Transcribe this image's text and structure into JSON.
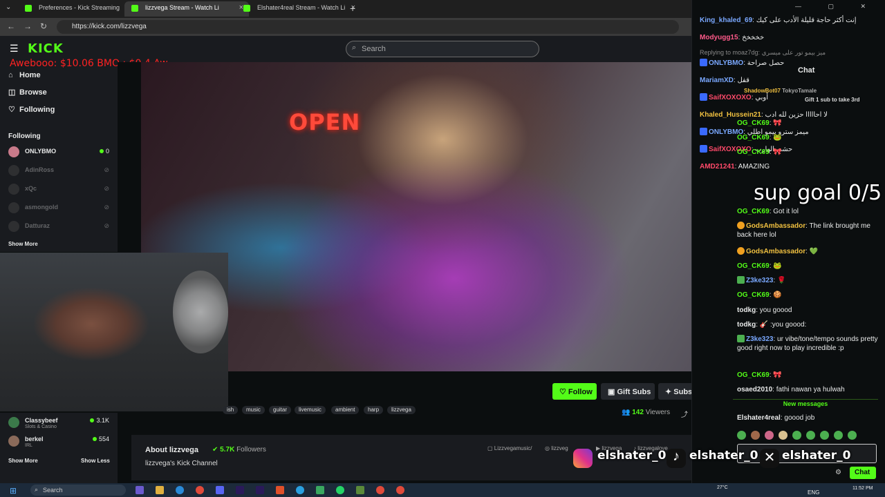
{
  "browser": {
    "tabs": [
      {
        "label": "Preferences - Kick Streaming",
        "active": false
      },
      {
        "label": "lizzvega Stream - Watch Li",
        "active": true
      },
      {
        "label": "Elshater4real Stream - Watch Li",
        "active": false
      }
    ],
    "url": "https://kick.com/lizzvega"
  },
  "kick": {
    "logo": "KICK",
    "search_placeholder": "Search"
  },
  "overlay_text": "Awebooo: $10.06    BMO : $0.4    Aw",
  "sidebar": {
    "nav": [
      {
        "label": "Home",
        "icon": "home-icon"
      },
      {
        "label": "Browse",
        "icon": "compass-icon"
      },
      {
        "label": "Following",
        "icon": "heart-icon"
      }
    ],
    "following_title": "Following",
    "channels": [
      {
        "name": "ONLYBMO",
        "viewers": "0",
        "live": true
      },
      {
        "name": "AdinRoss",
        "viewers": "",
        "live": false
      },
      {
        "name": "xQc",
        "viewers": "",
        "live": false
      },
      {
        "name": "asmongold",
        "viewers": "",
        "live": false
      },
      {
        "name": "Datturaz",
        "viewers": "",
        "live": false
      }
    ],
    "show_more": "Show More",
    "recommended": [
      {
        "name": "Classybeef",
        "category": "Slots & Casino",
        "viewers": "3.1K"
      },
      {
        "name": "berkel",
        "category": "IRL",
        "viewers": "554"
      }
    ],
    "show_more_2": "Show More",
    "show_less": "Show Less"
  },
  "stream": {
    "sign": "OPEN",
    "actions": {
      "follow": "Follow",
      "gift": "Gift Subs",
      "subscribe": "Subscribe"
    },
    "tags": [
      "ish",
      "music",
      "guitar",
      "livemusic",
      "ambient",
      "harp",
      "lizzvega"
    ],
    "viewers": "142",
    "viewers_label": "Viewers",
    "about_title": "About lizzvega",
    "followers": "5.7K",
    "followers_label": "Followers",
    "about_sub": "lizzvega's Kick Channel",
    "socials": [
      "Lizzvegamusic/",
      "lizzveg",
      "lizzvega",
      "lizzvegalove"
    ]
  },
  "chat": {
    "title": "Chat",
    "goal": "sup goal 0/5",
    "back_messages": [
      {
        "user": "King_khaled_69",
        "color": "#7aa8ff",
        "text": "إنت أكثر حاجة قليلة الأدب على كيك"
      },
      {
        "user": "Modyugg15",
        "color": "#ff5a8a",
        "text": "خخخخخ"
      },
      {
        "user": "",
        "color": "#888888",
        "text": "Replying to moaz7dg: ميز بيمو تور على ميسري"
      },
      {
        "user": "ONLYBMO",
        "color": "#7aa8ff",
        "text": "حصل صراحة"
      },
      {
        "user": "MariamXD",
        "color": "#7aa8ff",
        "text": "قفل"
      },
      {
        "user": "SaifXOXOXO",
        "color": "#ff4a6a",
        "text": "أوبي"
      },
      {
        "user": "Khaled_Hussein21",
        "color": "#f0c040",
        "text": "لا احااااا حزين لله ادب"
      },
      {
        "user": "ONLYBMO",
        "color": "#7aa8ff",
        "text": "ميمز سترو بيمو اطلي"
      },
      {
        "user": "SaifXOXOXO",
        "color": "#ff4a6a",
        "text": "حشي الهارب"
      },
      {
        "user": "AMD21241",
        "color": "#ff4a6a",
        "text": ""
      }
    ],
    "messages": [
      {
        "user": "OG_CK69",
        "color": "#53fc18",
        "text": ""
      },
      {
        "user": "OG_CK69",
        "color": "#53fc18",
        "text": ""
      },
      {
        "user": "OG_CK69",
        "color": "#53fc18",
        "text": ""
      },
      {
        "user": "",
        "color": "#e9eaea",
        "text": "AMAZING"
      },
      {
        "user": "OG_CK69",
        "color": "#53fc18",
        "text": "Got it lol"
      },
      {
        "user": "GodsAmbassador",
        "color": "#f0c040",
        "text": "The link brought me back here lol"
      },
      {
        "user": "GodsAmbassador",
        "color": "#f0c040",
        "text": "💚"
      },
      {
        "user": "OG_CK69",
        "color": "#53fc18",
        "text": ""
      },
      {
        "user": "Z3ke323",
        "color": "#7aa8ff",
        "text": ""
      },
      {
        "user": "OG_CK69",
        "color": "#53fc18",
        "text": ""
      },
      {
        "user": "todkg",
        "color": "#e9eaea",
        "text": "you goood"
      },
      {
        "user": "todkg",
        "color": "#e9eaea",
        "text": ":you goood:"
      },
      {
        "user": "Z3ke323",
        "color": "#7aa8ff",
        "text": "ur vibe/tone/tempo sounds pretty good right now to play incredible :p"
      },
      {
        "user": "OG_CK69",
        "color": "#53fc18",
        "text": ""
      },
      {
        "user": "osaed2010",
        "color": "#e9eaea",
        "text": "fathi nawan ya hulwah"
      }
    ],
    "new_messages": "New messages",
    "last_message": {
      "user": "Elshater4real",
      "color": "#e9eaea",
      "text": "goood job"
    },
    "send_button": "Chat",
    "gift_promo": "Gift 1 sub to take 3rd",
    "gift_users": [
      "ShadowBot07",
      "TokyoTamale"
    ]
  },
  "watermark": {
    "handles": [
      "elshater_0",
      "elshater_0",
      "elshater_0"
    ]
  },
  "taskbar": {
    "search": "Search",
    "weather": "27°C",
    "lang": "ENG",
    "time": "11:52 PM"
  }
}
